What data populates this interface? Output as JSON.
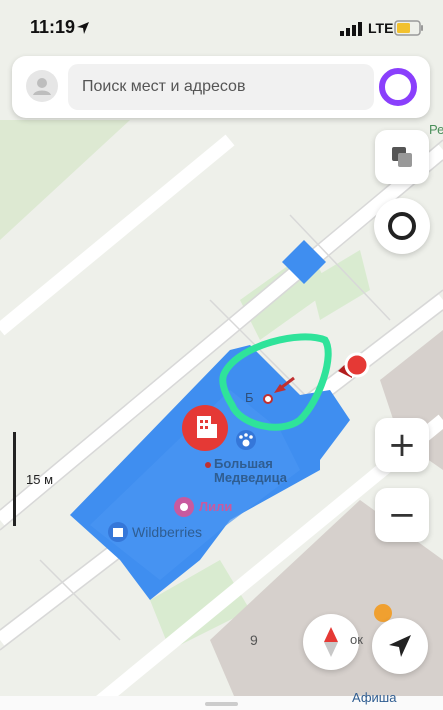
{
  "status_bar": {
    "time": "11:19",
    "network": "LTE"
  },
  "search": {
    "placeholder": "Поиск мест и адресов"
  },
  "map": {
    "scale_label": "15 м",
    "building_letter": "Б",
    "poi_bolshaya": "Большая\nМедведица",
    "poi_lili": "Лили",
    "poi_wildberries": "Wildberries",
    "building_number": "9",
    "edge_top_right": "Ре",
    "edge_bottom_right": "Афиша",
    "edge_right_partial": "ок"
  },
  "controls": {
    "zoom_in": "+",
    "zoom_out": "−"
  },
  "colors": {
    "building_blue": "#3f8ef0",
    "poi_red": "#e53935",
    "annotation_green": "#2fe39a",
    "alice_purple": "#8a3ffc"
  },
  "icons": [
    "location-arrow-icon",
    "signal-icon",
    "battery-icon",
    "user-icon",
    "alice-icon",
    "layers-icon",
    "route-icon",
    "compass-icon",
    "navigate-icon",
    "building-poi-icon",
    "paw-icon",
    "flower-icon",
    "bag-icon"
  ]
}
